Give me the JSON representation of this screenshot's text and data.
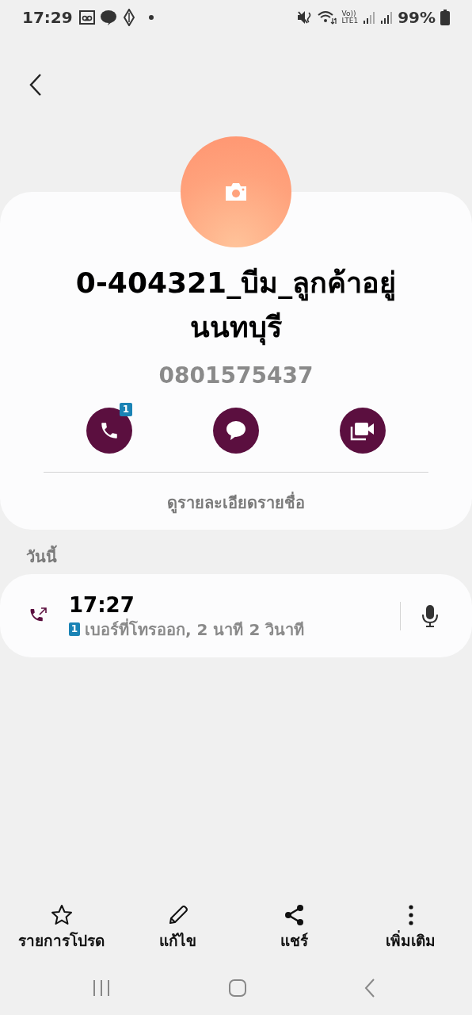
{
  "status_bar": {
    "time": "17:29",
    "volte": "Vo))",
    "lte": "LTE1",
    "battery": "99%"
  },
  "contact": {
    "name": "0-404321_บีม_ลูกค้าอยู่นนทบุรี",
    "phone": "0801575437",
    "actions": [
      {
        "kind": "call",
        "badge": "1"
      },
      {
        "kind": "message"
      },
      {
        "kind": "video"
      }
    ],
    "details_link": "ดูรายละเอียดรายชื่อ"
  },
  "call_log": {
    "section": "วันนี้",
    "entries": [
      {
        "kind": "outgoing",
        "time": "17:27",
        "sim": "1",
        "detail": "เบอร์ที่โทรออก, 2 นาที 2 วินาที"
      }
    ]
  },
  "bottom_actions": [
    {
      "kind": "favorite",
      "label": "รายการโปรด"
    },
    {
      "kind": "edit",
      "label": "แก้ไข"
    },
    {
      "kind": "share",
      "label": "แชร์"
    },
    {
      "kind": "more",
      "label": "เพิ่มเติม"
    }
  ]
}
